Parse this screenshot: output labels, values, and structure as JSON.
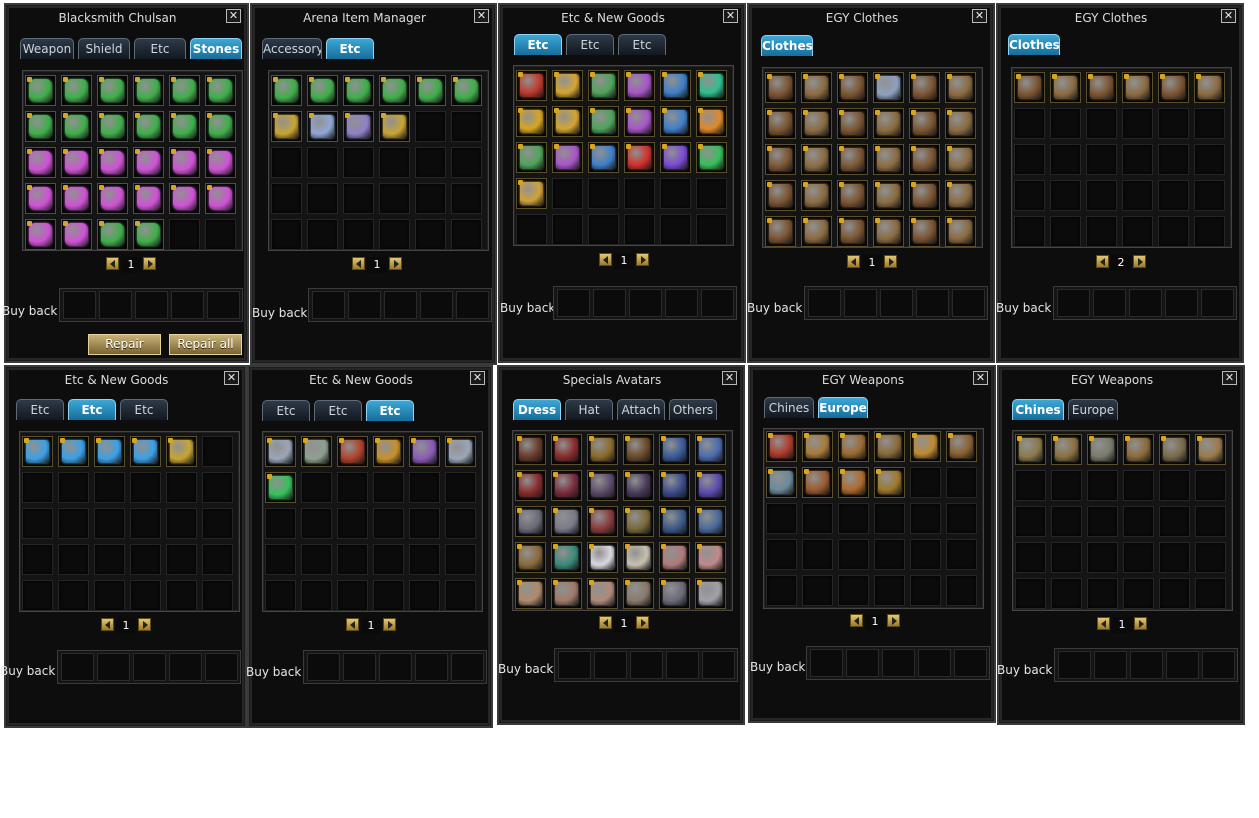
{
  "panels": [
    {
      "title": "Blacksmith Chulsan",
      "tabs": [
        {
          "label": "Weapon",
          "active": false
        },
        {
          "label": "Shield",
          "active": false
        },
        {
          "label": "Etc",
          "active": false
        },
        {
          "label": "Stones",
          "active": true
        }
      ],
      "items": [
        {
          "name": "green-stone",
          "color": "#3fae4a"
        },
        {
          "name": "green-stone",
          "color": "#3fae4a"
        },
        {
          "name": "green-stone",
          "color": "#3fae4a"
        },
        {
          "name": "green-stone",
          "color": "#3fae4a"
        },
        {
          "name": "green-stone",
          "color": "#3fae4a"
        },
        {
          "name": "green-stone",
          "color": "#3fae4a"
        },
        {
          "name": "green-stone",
          "color": "#3fae4a"
        },
        {
          "name": "green-stone",
          "color": "#3fae4a"
        },
        {
          "name": "green-stone",
          "color": "#3fae4a"
        },
        {
          "name": "green-stone",
          "color": "#3fae4a"
        },
        {
          "name": "green-stone",
          "color": "#3fae4a"
        },
        {
          "name": "green-stone",
          "color": "#3fae4a"
        },
        {
          "name": "pink-stone",
          "color": "#cf52d6"
        },
        {
          "name": "pink-stone",
          "color": "#cf52d6"
        },
        {
          "name": "pink-stone",
          "color": "#cf52d6"
        },
        {
          "name": "pink-stone",
          "color": "#cf52d6"
        },
        {
          "name": "pink-stone",
          "color": "#cf52d6"
        },
        {
          "name": "pink-stone",
          "color": "#cf52d6"
        },
        {
          "name": "pink-stone",
          "color": "#cf52d6"
        },
        {
          "name": "pink-stone",
          "color": "#cf52d6"
        },
        {
          "name": "pink-stone",
          "color": "#cf52d6"
        },
        {
          "name": "pink-stone",
          "color": "#cf52d6"
        },
        {
          "name": "pink-stone",
          "color": "#cf52d6"
        },
        {
          "name": "pink-stone",
          "color": "#cf52d6"
        },
        {
          "name": "pink-stone",
          "color": "#cf52d6"
        },
        {
          "name": "pink-stone",
          "color": "#cf52d6"
        },
        {
          "name": "green-stone",
          "color": "#3fae4a"
        },
        {
          "name": "green-stone",
          "color": "#3fae4a"
        }
      ],
      "page": "1",
      "buyback_label": "Buy back",
      "buttons": [
        {
          "label": "Repair"
        },
        {
          "label": "Repair all"
        }
      ]
    },
    {
      "title": "Arena Item Manager",
      "tabs": [
        {
          "label": "Accessory",
          "active": false
        },
        {
          "label": "Etc",
          "active": true
        }
      ],
      "items": [
        {
          "name": "green-stone",
          "color": "#3fae4a"
        },
        {
          "name": "green-stone",
          "color": "#3fae4a"
        },
        {
          "name": "green-stone",
          "color": "#3fae4a"
        },
        {
          "name": "green-stone",
          "color": "#3fae4a"
        },
        {
          "name": "green-stone",
          "color": "#3fae4a"
        },
        {
          "name": "green-stone",
          "color": "#3fae4a"
        },
        {
          "name": "gold-potion",
          "color": "#c9a432"
        },
        {
          "name": "blue-potion",
          "color": "#8fa7d8"
        },
        {
          "name": "purple-potion",
          "color": "#9080c8"
        },
        {
          "name": "gold-potion",
          "color": "#c9a432"
        }
      ],
      "page": "1",
      "buyback_label": "Buy back"
    },
    {
      "title": "Etc & New Goods",
      "tabs": [
        {
          "label": "Etc",
          "active": true
        },
        {
          "label": "Etc",
          "active": false
        },
        {
          "label": "Etc",
          "active": false
        }
      ],
      "items": [
        {
          "name": "red-scroll",
          "color": "#c0392b"
        },
        {
          "name": "gold-potion",
          "color": "#d4a531"
        },
        {
          "name": "green-potion",
          "color": "#4fa35a"
        },
        {
          "name": "purple-potion",
          "color": "#a855c8"
        },
        {
          "name": "blue-potion",
          "color": "#3f7fc9"
        },
        {
          "name": "emerald",
          "color": "#2fbf8f"
        },
        {
          "name": "gold-medal",
          "color": "#d9a520"
        },
        {
          "name": "gold-potion",
          "color": "#d4a531"
        },
        {
          "name": "green-potion",
          "color": "#4fa35a"
        },
        {
          "name": "purple-potion",
          "color": "#a855c8"
        },
        {
          "name": "blue-potion",
          "color": "#3f7fc9"
        },
        {
          "name": "orange-potion",
          "color": "#e08a2a"
        },
        {
          "name": "green-potion",
          "color": "#4fa35a"
        },
        {
          "name": "purple-potion",
          "color": "#a855c8"
        },
        {
          "name": "blue-potion",
          "color": "#3f7fc9"
        },
        {
          "name": "red-gem",
          "color": "#d2302a"
        },
        {
          "name": "purple-orb",
          "color": "#7b4ad6"
        },
        {
          "name": "green-orb",
          "color": "#36c05a"
        },
        {
          "name": "gold-horn",
          "color": "#d2a23a"
        }
      ],
      "page": "1",
      "buyback_label": "Buy back"
    },
    {
      "title": "EGY Clothes",
      "tabs": [
        {
          "label": "Clothes",
          "active": true
        }
      ],
      "items": [
        {
          "name": "armor",
          "color": "#7a5330"
        },
        {
          "name": "armor",
          "color": "#8a6a40"
        },
        {
          "name": "armor",
          "color": "#7a5330"
        },
        {
          "name": "robe",
          "color": "#8ea0c0"
        },
        {
          "name": "armor",
          "color": "#7a5330"
        },
        {
          "name": "armor",
          "color": "#8a6a40"
        },
        {
          "name": "armor",
          "color": "#7a5330"
        },
        {
          "name": "armor",
          "color": "#8a6a40"
        },
        {
          "name": "armor",
          "color": "#7a5330"
        },
        {
          "name": "armor",
          "color": "#8a6a40"
        },
        {
          "name": "armor",
          "color": "#7a5330"
        },
        {
          "name": "armor",
          "color": "#8a6a40"
        },
        {
          "name": "armor",
          "color": "#7a5330"
        },
        {
          "name": "armor",
          "color": "#8a6a40"
        },
        {
          "name": "armor",
          "color": "#7a5330"
        },
        {
          "name": "armor",
          "color": "#8a6a40"
        },
        {
          "name": "armor",
          "color": "#7a5330"
        },
        {
          "name": "armor",
          "color": "#8a6a40"
        },
        {
          "name": "armor",
          "color": "#7a5330"
        },
        {
          "name": "armor",
          "color": "#8a6a40"
        },
        {
          "name": "armor",
          "color": "#7a5330"
        },
        {
          "name": "armor",
          "color": "#8a6a40"
        },
        {
          "name": "armor",
          "color": "#7a5330"
        },
        {
          "name": "armor",
          "color": "#8a6a40"
        },
        {
          "name": "armor",
          "color": "#7a5330"
        },
        {
          "name": "armor",
          "color": "#8a6a40"
        },
        {
          "name": "armor",
          "color": "#7a5330"
        },
        {
          "name": "armor",
          "color": "#8a6a40"
        },
        {
          "name": "armor",
          "color": "#7a5330"
        },
        {
          "name": "armor",
          "color": "#8a6a40"
        }
      ],
      "page": "1",
      "buyback_label": "Buy back"
    },
    {
      "title": "EGY Clothes",
      "tabs": [
        {
          "label": "Clothes",
          "active": true
        }
      ],
      "items": [
        {
          "name": "armor",
          "color": "#7a5330"
        },
        {
          "name": "armor",
          "color": "#8a6a40"
        },
        {
          "name": "armor",
          "color": "#7a5330"
        },
        {
          "name": "armor",
          "color": "#8a6a40"
        },
        {
          "name": "armor",
          "color": "#7a5330"
        },
        {
          "name": "armor",
          "color": "#8a6a40"
        }
      ],
      "page": "2",
      "buyback_label": "Buy back"
    },
    {
      "title": "Etc & New Goods",
      "tabs": [
        {
          "label": "Etc",
          "active": false
        },
        {
          "label": "Etc",
          "active": true
        },
        {
          "label": "Etc",
          "active": false
        }
      ],
      "items": [
        {
          "name": "blue-crystal",
          "color": "#3aa0e8"
        },
        {
          "name": "blue-crystal",
          "color": "#3aa0e8"
        },
        {
          "name": "blue-crystal",
          "color": "#3aa0e8"
        },
        {
          "name": "blue-crystal",
          "color": "#3aa0e8"
        },
        {
          "name": "gold-bell",
          "color": "#c9a432"
        }
      ],
      "page": "1",
      "buyback_label": "Buy back"
    },
    {
      "title": "Etc & New Goods",
      "tabs": [
        {
          "label": "Etc",
          "active": false
        },
        {
          "label": "Etc",
          "active": false
        },
        {
          "label": "Etc",
          "active": true
        }
      ],
      "items": [
        {
          "name": "silver-item",
          "color": "#9aa6b8"
        },
        {
          "name": "silver-item",
          "color": "#8ea090"
        },
        {
          "name": "red-item",
          "color": "#b0402a"
        },
        {
          "name": "gold-item",
          "color": "#c8902a"
        },
        {
          "name": "purple-item",
          "color": "#8a5ab8"
        },
        {
          "name": "silver-item",
          "color": "#9aa6b8"
        },
        {
          "name": "green-orb",
          "color": "#36c05a"
        }
      ],
      "page": "1",
      "buyback_label": "Buy back"
    },
    {
      "title": "Specials Avatars",
      "tabs": [
        {
          "label": "Dress",
          "active": true
        },
        {
          "label": "Hat",
          "active": false
        },
        {
          "label": "Attach",
          "active": false
        },
        {
          "label": "Others",
          "active": false
        }
      ],
      "items": [
        {
          "name": "avatar",
          "color": "#6a3a2a"
        },
        {
          "name": "avatar",
          "color": "#8a2a2a"
        },
        {
          "name": "avatar",
          "color": "#8a6a2a"
        },
        {
          "name": "avatar",
          "color": "#6a4a2a"
        },
        {
          "name": "avatar",
          "color": "#3a5a9a"
        },
        {
          "name": "avatar",
          "color": "#4a6ab0"
        },
        {
          "name": "avatar",
          "color": "#8a2a2a"
        },
        {
          "name": "avatar",
          "color": "#7a2a3a"
        },
        {
          "name": "avatar",
          "color": "#5a4a6a"
        },
        {
          "name": "avatar",
          "color": "#4a3a5a"
        },
        {
          "name": "avatar",
          "color": "#3a4a8a"
        },
        {
          "name": "avatar",
          "color": "#5a4ab0"
        },
        {
          "name": "avatar",
          "color": "#6a6a7a"
        },
        {
          "name": "avatar",
          "color": "#7a7a8a"
        },
        {
          "name": "avatar",
          "color": "#8a3a3a"
        },
        {
          "name": "avatar",
          "color": "#7a6a3a"
        },
        {
          "name": "avatar",
          "color": "#3a5a8a"
        },
        {
          "name": "avatar",
          "color": "#4a6a9a"
        },
        {
          "name": "avatar",
          "color": "#8a6a3a"
        },
        {
          "name": "avatar",
          "color": "#3a8a7a"
        },
        {
          "name": "avatar",
          "color": "#d8d8e0"
        },
        {
          "name": "avatar",
          "color": "#c8c0b0"
        },
        {
          "name": "avatar",
          "color": "#b07a7a"
        },
        {
          "name": "avatar",
          "color": "#c08a8a"
        },
        {
          "name": "avatar",
          "color": "#b08a6a"
        },
        {
          "name": "avatar",
          "color": "#a07a6a"
        },
        {
          "name": "avatar",
          "color": "#b08a7a"
        },
        {
          "name": "avatar",
          "color": "#8a7a6a"
        },
        {
          "name": "avatar",
          "color": "#6a6a7a"
        },
        {
          "name": "avatar",
          "color": "#a0a0a8"
        }
      ],
      "page": "1",
      "buyback_label": "Buy back"
    },
    {
      "title": "EGY Weapons",
      "tabs": [
        {
          "label": "Chines",
          "active": false
        },
        {
          "label": "Europe",
          "active": true
        }
      ],
      "items": [
        {
          "name": "weapon",
          "color": "#b03a2a"
        },
        {
          "name": "weapon",
          "color": "#a87a3a"
        },
        {
          "name": "weapon",
          "color": "#9a6a30"
        },
        {
          "name": "weapon",
          "color": "#8a6a3a"
        },
        {
          "name": "weapon",
          "color": "#c08a30"
        },
        {
          "name": "weapon",
          "color": "#8a6030"
        },
        {
          "name": "weapon",
          "color": "#6a8a9a"
        },
        {
          "name": "weapon",
          "color": "#9a5a30"
        },
        {
          "name": "weapon",
          "color": "#b06a2a"
        },
        {
          "name": "weapon",
          "color": "#a0782a"
        }
      ],
      "page": "1",
      "buyback_label": "Buy back"
    },
    {
      "title": "EGY Weapons",
      "tabs": [
        {
          "label": "Chines",
          "active": true
        },
        {
          "label": "Europe",
          "active": false
        }
      ],
      "items": [
        {
          "name": "weapon",
          "color": "#8a7a4a"
        },
        {
          "name": "weapon",
          "color": "#8a7040"
        },
        {
          "name": "weapon",
          "color": "#7a7a6a"
        },
        {
          "name": "weapon",
          "color": "#8a6a3a"
        },
        {
          "name": "weapon",
          "color": "#7a6a4a"
        },
        {
          "name": "weapon",
          "color": "#9a7a4a"
        }
      ],
      "page": "1",
      "buyback_label": "Buy back"
    }
  ]
}
